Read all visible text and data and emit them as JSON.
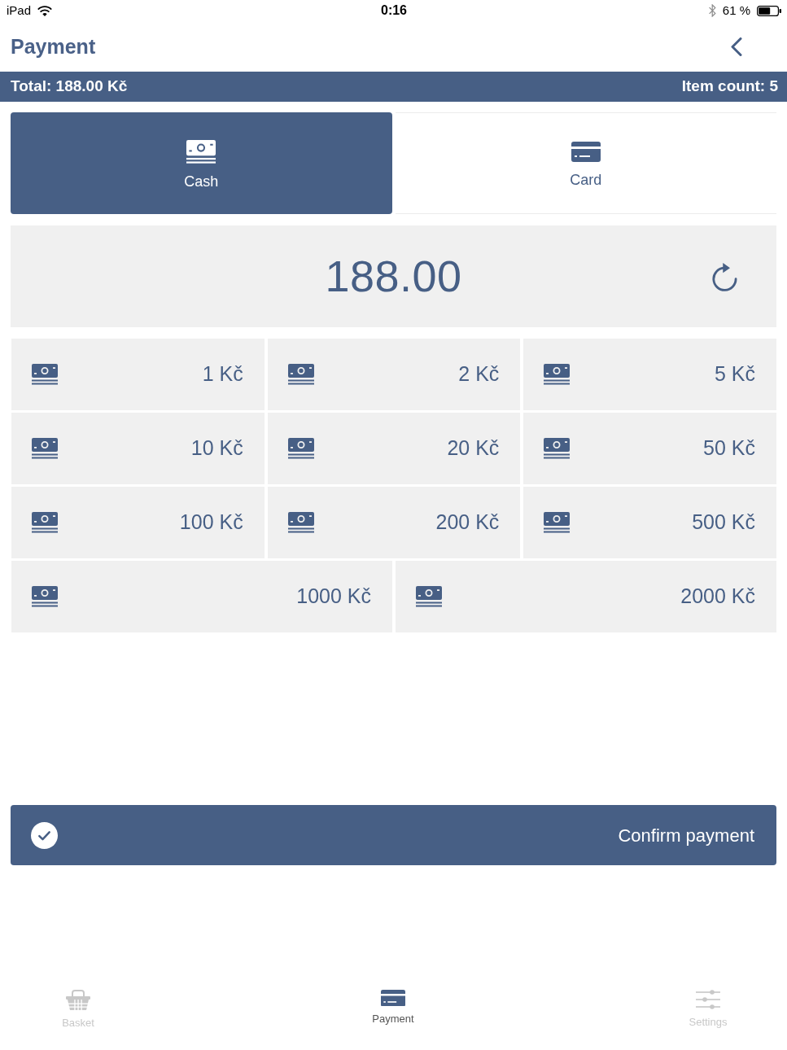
{
  "status_bar": {
    "device": "iPad",
    "time": "0:16",
    "battery": "61 %"
  },
  "header": {
    "title": "Payment"
  },
  "summary": {
    "total": "Total: 188.00 Kč",
    "item_count": "Item count: 5"
  },
  "payment_methods": [
    {
      "label": "Cash",
      "kind": "cash",
      "selected": true
    },
    {
      "label": "Card",
      "kind": "card",
      "selected": false
    }
  ],
  "amount": {
    "value": "188.00"
  },
  "denomination_rows": [
    {
      "items": [
        {
          "label": "1 Kč"
        },
        {
          "label": "2 Kč"
        },
        {
          "label": "5 Kč"
        }
      ]
    },
    {
      "items": [
        {
          "label": "10 Kč"
        },
        {
          "label": "20 Kč"
        },
        {
          "label": "50 Kč"
        }
      ]
    },
    {
      "items": [
        {
          "label": "100 Kč"
        },
        {
          "label": "200 Kč"
        },
        {
          "label": "500 Kč"
        }
      ]
    },
    {
      "items": [
        {
          "label": "1000 Kč"
        },
        {
          "label": "2000 Kč"
        }
      ]
    }
  ],
  "confirm_button": {
    "label": "Confirm payment"
  },
  "tab_bar": [
    {
      "label": "Basket",
      "kind": "basket",
      "selected": false
    },
    {
      "label": "Payment",
      "kind": "card",
      "selected": true
    },
    {
      "label": "Settings",
      "kind": "settings",
      "selected": false
    }
  ]
}
